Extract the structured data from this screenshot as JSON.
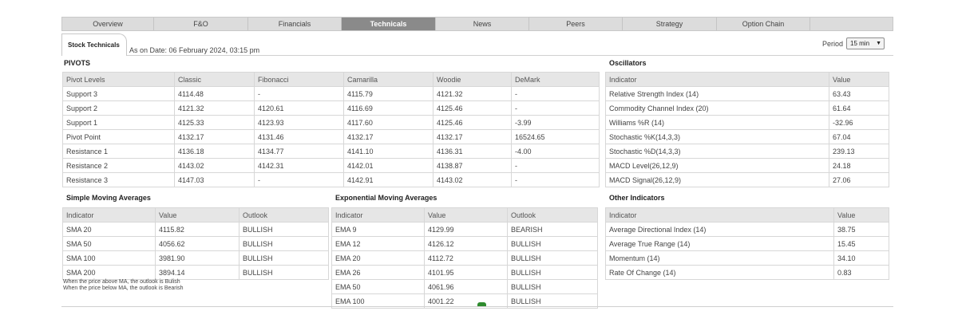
{
  "tabs": [
    {
      "label": "Overview",
      "active": false
    },
    {
      "label": "F&O",
      "active": false
    },
    {
      "label": "Financials",
      "active": false
    },
    {
      "label": "Technicals",
      "active": true
    },
    {
      "label": "News",
      "active": false
    },
    {
      "label": "Peers",
      "active": false
    },
    {
      "label": "Strategy",
      "active": false
    },
    {
      "label": "Option Chain",
      "active": false
    }
  ],
  "header": {
    "subtab_label": "Stock Technicals",
    "as_on": "As on Date: 06 February 2024, 03:15 pm",
    "period_label": "Period",
    "period_value": "15 min"
  },
  "pivots": {
    "title": "PIVOTS",
    "headers": [
      "Pivot Levels",
      "Classic",
      "Fibonacci",
      "Camarilla",
      "Woodie",
      "DeMark"
    ],
    "rows": [
      [
        "Support 3",
        "4114.48",
        "-",
        "4115.79",
        "4121.32",
        "-"
      ],
      [
        "Support 2",
        "4121.32",
        "4120.61",
        "4116.69",
        "4125.46",
        "-"
      ],
      [
        "Support 1",
        "4125.33",
        "4123.93",
        "4117.60",
        "4125.46",
        "-3.99"
      ],
      [
        "Pivot Point",
        "4132.17",
        "4131.46",
        "4132.17",
        "4132.17",
        "16524.65"
      ],
      [
        "Resistance 1",
        "4136.18",
        "4134.77",
        "4141.10",
        "4136.31",
        "-4.00"
      ],
      [
        "Resistance 2",
        "4143.02",
        "4142.31",
        "4142.01",
        "4138.87",
        "-"
      ],
      [
        "Resistance 3",
        "4147.03",
        "-",
        "4142.91",
        "4143.02",
        "-"
      ]
    ]
  },
  "oscillators": {
    "title": "Oscillators",
    "headers": [
      "Indicator",
      "Value"
    ],
    "rows": [
      [
        "Relative Strength Index (14)",
        "63.43"
      ],
      [
        "Commodity Channel Index (20)",
        "61.64"
      ],
      [
        "Williams %R (14)",
        "-32.96"
      ],
      [
        "Stochastic %K(14,3,3)",
        "67.04"
      ],
      [
        "Stochastic %D(14,3,3)",
        "239.13"
      ],
      [
        "MACD Level(26,12,9)",
        "24.18"
      ],
      [
        "MACD Signal(26,12,9)",
        "27.06"
      ]
    ]
  },
  "sma": {
    "title": "Simple Moving Averages",
    "headers": [
      "Indicator",
      "Value",
      "Outlook"
    ],
    "rows": [
      [
        "SMA 20",
        "4115.82",
        "BULLISH"
      ],
      [
        "SMA 50",
        "4056.62",
        "BULLISH"
      ],
      [
        "SMA 100",
        "3981.90",
        "BULLISH"
      ],
      [
        "SMA 200",
        "3894.14",
        "BULLISH"
      ]
    ],
    "notes": [
      "When the price above MA, the outlook is Bulish",
      "When the price below MA, the outlook is Bearish"
    ]
  },
  "ema": {
    "title": "Exponential Moving Averages",
    "headers": [
      "Indicator",
      "Value",
      "Outlook"
    ],
    "rows": [
      [
        "EMA 9",
        "4129.99",
        "BEARISH"
      ],
      [
        "EMA 12",
        "4126.12",
        "BULLISH"
      ],
      [
        "EMA 20",
        "4112.72",
        "BULLISH"
      ],
      [
        "EMA 26",
        "4101.95",
        "BULLISH"
      ],
      [
        "EMA 50",
        "4061.96",
        "BULLISH"
      ],
      [
        "EMA 100",
        "4001.22",
        "BULLISH"
      ]
    ]
  },
  "other": {
    "title": "Other Indicators",
    "headers": [
      "Indicator",
      "Value"
    ],
    "rows": [
      [
        "Average Directional Index (14)",
        "38.75"
      ],
      [
        "Average True Range (14)",
        "15.45"
      ],
      [
        "Momentum (14)",
        "34.10"
      ],
      [
        "Rate Of Change (14)",
        "0.83"
      ]
    ]
  },
  "colors": {
    "bullish": "#2e8b2e",
    "bearish": "#e0282e",
    "active_tab": "#8a8a8a",
    "header_bg": "#e6e6e6"
  }
}
